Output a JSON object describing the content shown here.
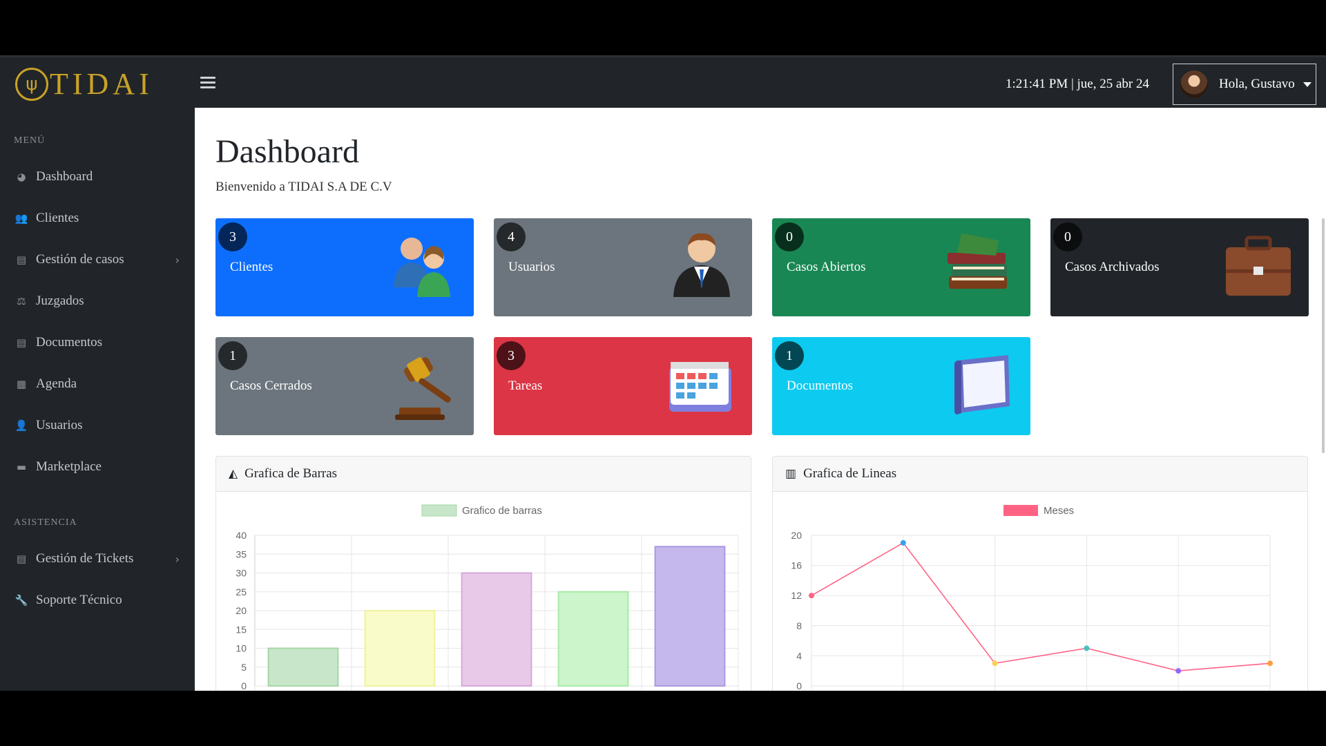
{
  "app": {
    "logo_text": "TIDAI",
    "logo_mark": "ψ"
  },
  "header": {
    "clock": "1:21:41 PM | jue, 25 abr 24",
    "user_label": "Hola, Gustavo"
  },
  "sidebar": {
    "heading_menu": "MENÚ",
    "heading_assist": "ASISTENCIA",
    "items": [
      {
        "label": "Dashboard",
        "icon": "dashboard-icon",
        "glyph": "◕"
      },
      {
        "label": "Clientes",
        "icon": "users-icon",
        "glyph": "👥"
      },
      {
        "label": "Gestión de casos",
        "icon": "file-icon",
        "glyph": "▤",
        "chevron": "›"
      },
      {
        "label": "Juzgados",
        "icon": "scale-icon",
        "glyph": "⚖"
      },
      {
        "label": "Documentos",
        "icon": "document-icon",
        "glyph": "▤"
      },
      {
        "label": "Agenda",
        "icon": "calendar-icon",
        "glyph": "▦"
      },
      {
        "label": "Usuarios",
        "icon": "user-icon",
        "glyph": "👤"
      },
      {
        "label": "Marketplace",
        "icon": "store-icon",
        "glyph": "▬"
      },
      {
        "label": "Gestión de Tickets",
        "icon": "file-icon",
        "glyph": "▤",
        "chevron": "›"
      },
      {
        "label": "Soporte Técnico",
        "icon": "wrench-icon",
        "glyph": "🔧"
      }
    ]
  },
  "main": {
    "title": "Dashboard",
    "welcome": "Bienvenido a TIDAI S.A DE C.V",
    "cards": [
      {
        "count": "3",
        "label": "Clientes",
        "color": "#0d6efd",
        "icon": "clients-icon"
      },
      {
        "count": "4",
        "label": "Usuarios",
        "color": "#6c757d",
        "icon": "user-suit-icon"
      },
      {
        "count": "0",
        "label": "Casos Abiertos",
        "color": "#198754",
        "icon": "books-icon"
      },
      {
        "count": "0",
        "label": "Casos Archivados",
        "color": "#212529",
        "icon": "briefcase-icon"
      },
      {
        "count": "1",
        "label": "Casos Cerrados",
        "color": "#6c757d",
        "icon": "gavel-icon"
      },
      {
        "count": "3",
        "label": "Tareas",
        "color": "#dc3545",
        "icon": "calendar-icon"
      },
      {
        "count": "1",
        "label": "Documentos",
        "color": "#0dcaf0",
        "icon": "folder-icon"
      }
    ],
    "bar_panel_title": "Grafica de Barras",
    "line_panel_title": "Grafica de Lineas"
  },
  "chart_data": [
    {
      "type": "bar",
      "legend": "Grafico de barras",
      "values": [
        10,
        20,
        30,
        25,
        37
      ],
      "colors": [
        "#c8e6c9",
        "#f9fbc8",
        "#e8c9e8",
        "#ccf5cc",
        "#c5b8ec"
      ],
      "border_colors": [
        "#a5d6a7",
        "#eef39a",
        "#d8a8d8",
        "#a6eba6",
        "#a999e0"
      ],
      "yticks": [
        0,
        5,
        10,
        15,
        20,
        25,
        30,
        35,
        40
      ],
      "ylim": [
        0,
        40
      ],
      "grid": true,
      "legend_position": "top"
    },
    {
      "type": "line",
      "legend": "Meses",
      "line_color": "#ff6384",
      "values": [
        12,
        19,
        3,
        5,
        2,
        3
      ],
      "point_colors": [
        "#ff6384",
        "#36a2eb",
        "#ffce56",
        "#4bc0c0",
        "#9966ff",
        "#ff9f40"
      ],
      "yticks": [
        0,
        4,
        8,
        12,
        16,
        20
      ],
      "ylim": [
        0,
        20
      ],
      "grid": true,
      "legend_position": "top"
    }
  ]
}
